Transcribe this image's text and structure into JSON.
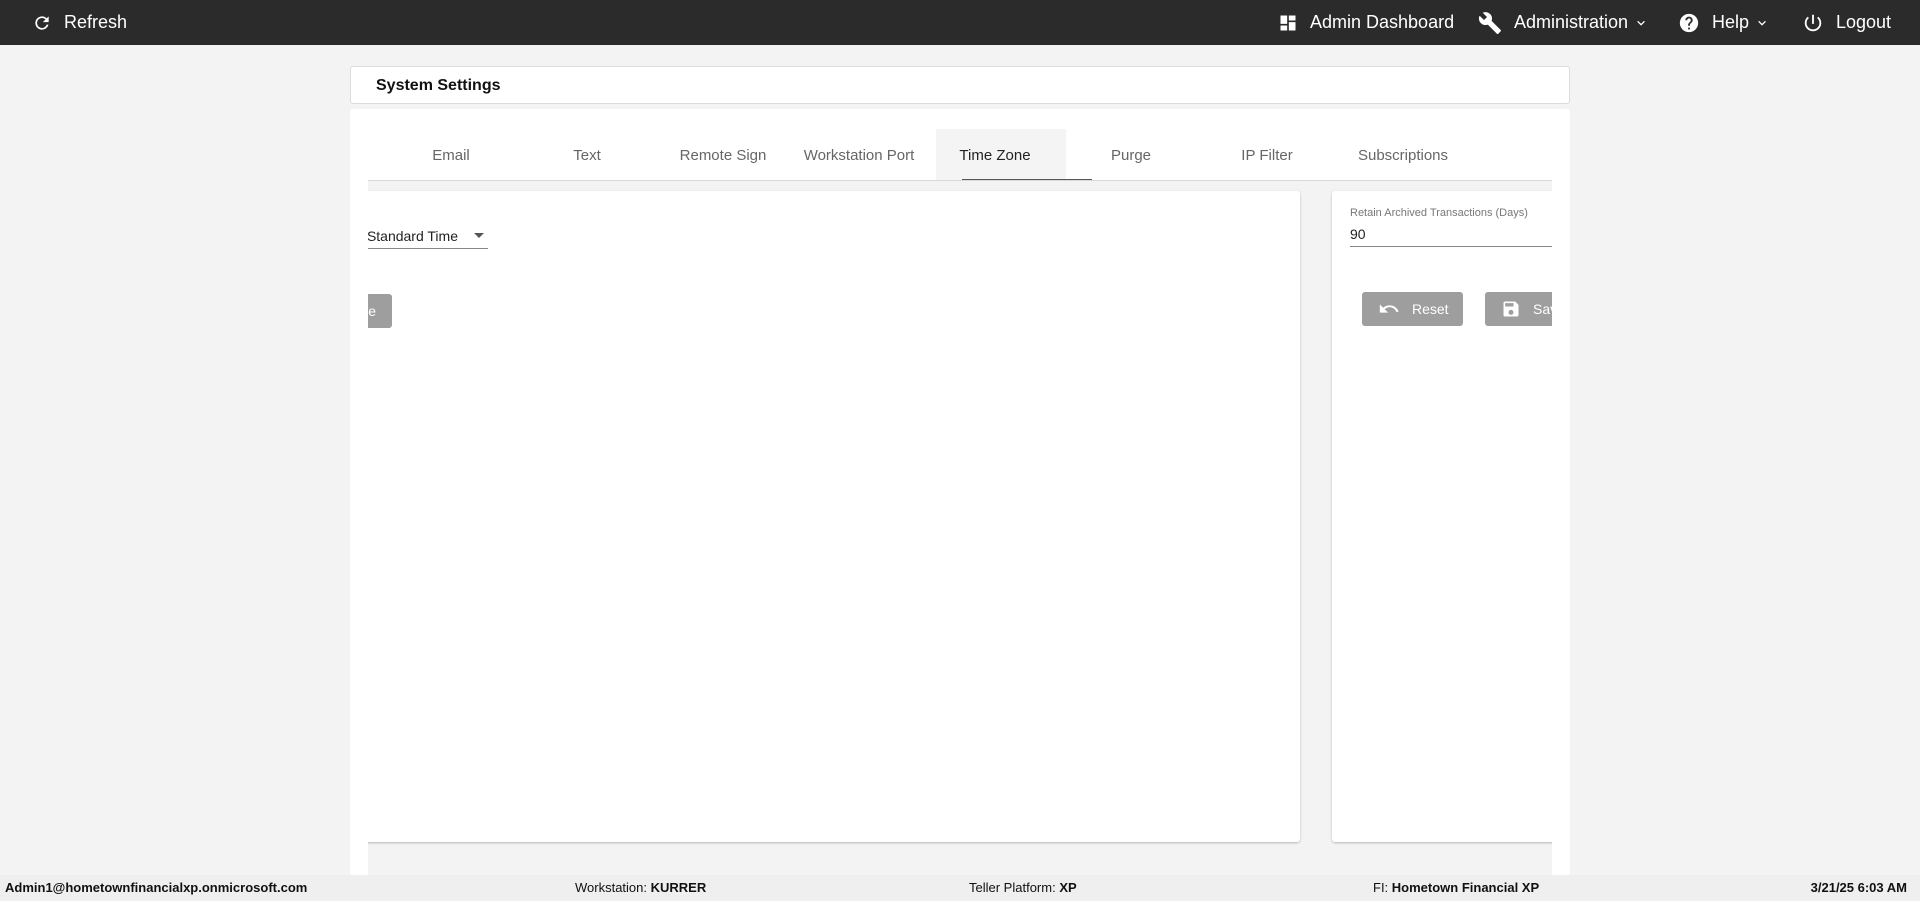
{
  "topbar": {
    "refresh_label": "Refresh",
    "admin_dashboard_label": "Admin Dashboard",
    "administration_label": "Administration",
    "help_label": "Help",
    "logout_label": "Logout"
  },
  "page": {
    "title": "System Settings"
  },
  "tabs": [
    {
      "label": "Email"
    },
    {
      "label": "Text"
    },
    {
      "label": "Remote Sign"
    },
    {
      "label": "Workstation Port"
    },
    {
      "label": "Time Zone"
    },
    {
      "label": "Purge"
    },
    {
      "label": "IP Filter"
    },
    {
      "label": "Subscriptions"
    }
  ],
  "active_tab": "Time Zone",
  "timezone": {
    "value": "Standard Time",
    "save_label": "Save"
  },
  "purge": {
    "retain_label": "Retain Archived Transactions (Days)",
    "retain_value": "90",
    "reset_label": "Reset",
    "save_label": "Save"
  },
  "statusbar": {
    "user": "Admin1@hometownfinancialxp.onmicrosoft.com",
    "workstation_label": "Workstation:",
    "workstation_value": "KURRER",
    "platform_label": "Teller Platform:",
    "platform_value": "XP",
    "fi_label": "FI:",
    "fi_value": "Hometown Financial XP",
    "datetime": "3/21/25 6:03 AM"
  },
  "colors": {
    "topbar_bg": "#2b2b2b",
    "tab_ink": "#3f51b5",
    "button_disabled": "#9e9e9e"
  }
}
